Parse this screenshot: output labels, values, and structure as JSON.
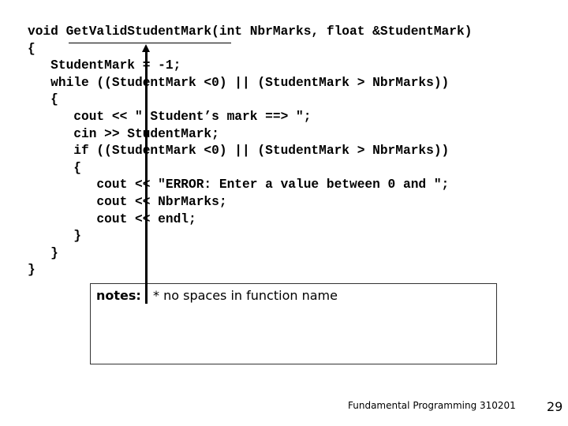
{
  "code": {
    "lines": [
      "void GetValidStudentMark(int NbrMarks, float &StudentMark)",
      "{",
      "   StudentMark = -1;",
      "   while ((StudentMark <0) || (StudentMark > NbrMarks))",
      "   {",
      "      cout << \" Student’s mark ==> \";",
      "      cin >> StudentMark;",
      "      if ((StudentMark <0) || (StudentMark > NbrMarks))",
      "      {",
      "         cout << \"ERROR: Enter a value between 0 and \";",
      "         cout << NbrMarks;",
      "         cout << endl;",
      "      }",
      "   }",
      "}"
    ]
  },
  "notes": {
    "label": "notes:",
    "text": "* no spaces in function name"
  },
  "footer": {
    "course": "Fundamental Programming 310201",
    "page_number": "29"
  }
}
